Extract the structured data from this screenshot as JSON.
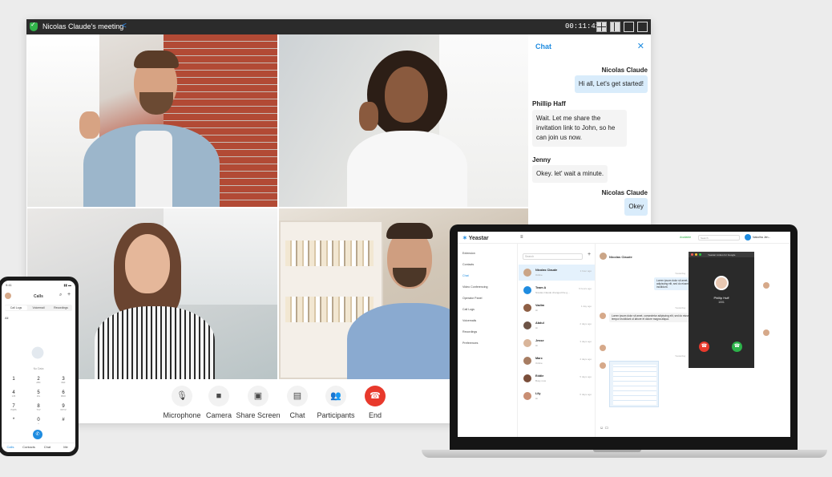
{
  "meeting": {
    "title": "Nicolas Claude's meeting",
    "timer": "00:11:41",
    "controls": [
      {
        "label": "Microphone",
        "icon": "microphone-icon"
      },
      {
        "label": "Camera",
        "icon": "camera-icon"
      },
      {
        "label": "Share Screen",
        "icon": "share-screen-icon"
      },
      {
        "label": "Chat",
        "icon": "chat-icon"
      },
      {
        "label": "Participants",
        "icon": "participants-icon"
      },
      {
        "label": "End",
        "icon": "end-call-icon"
      }
    ],
    "colors": {
      "end": "#e8392c",
      "accent": "#1f8ce0",
      "secure": "#32b34a"
    }
  },
  "chat": {
    "title": "Chat",
    "messages": [
      {
        "sender": "Nicolas Claude",
        "text": "Hi all, Let's get started!",
        "mine": true
      },
      {
        "sender": "Phillip Haff",
        "text": "Wait. Let me share the invitation link to John, so he can join us now.",
        "mine": false
      },
      {
        "sender": "Jenny",
        "text": "Okey. let' wait a minute.",
        "mine": false
      },
      {
        "sender": "Nicolas Claude",
        "text": "Okey",
        "mine": true
      }
    ]
  },
  "phone": {
    "status_time": "9:41",
    "title": "Calls",
    "tabs": [
      "Call Logs",
      "Voicemail",
      "Recordings"
    ],
    "filter": "All",
    "empty_label": "No Data",
    "keypad": [
      {
        "d": "1",
        "l": ""
      },
      {
        "d": "2",
        "l": "ABC"
      },
      {
        "d": "3",
        "l": "DEF"
      },
      {
        "d": "4",
        "l": "GHI"
      },
      {
        "d": "5",
        "l": "JKL"
      },
      {
        "d": "6",
        "l": "MNO"
      },
      {
        "d": "7",
        "l": "PQRS"
      },
      {
        "d": "8",
        "l": "TUV"
      },
      {
        "d": "9",
        "l": "WXYZ"
      },
      {
        "d": "*",
        "l": ""
      },
      {
        "d": "0",
        "l": "+"
      },
      {
        "d": "#",
        "l": ""
      }
    ],
    "nav": [
      "Calls",
      "Contacts",
      "Chat",
      "Me"
    ]
  },
  "laptop": {
    "brand": "Yeastar",
    "availability": "Available",
    "user": "Nakolha Jen...",
    "search_placeholder": "Search",
    "sidebar": [
      "Extension",
      "Contacts",
      "Chat",
      "Video Conferencing",
      "Operator Panel",
      "Call Logs",
      "Voicemails",
      "Recordings",
      "Preferences"
    ],
    "active_sidebar": "Chat",
    "conversations": [
      {
        "name": "Nicolas Claude",
        "sub": "Online",
        "time": "1 hour ago",
        "active": true
      },
      {
        "name": "Team A",
        "sub": "Nicolas Claude changed the g...",
        "time": "6 hours ago",
        "active": false
      },
      {
        "name": "Vadim",
        "sub": "Hi",
        "time": "1 day ago",
        "active": false
      },
      {
        "name": "Abdul",
        "sub": "Hi",
        "time": "2 days ago",
        "active": false
      },
      {
        "name": "Jesse",
        "sub": "Hi",
        "time": "3 days ago",
        "active": false
      },
      {
        "name": "Marc",
        "sub": "Online",
        "time": "4 days ago",
        "active": false
      },
      {
        "name": "Eddie",
        "sub": "Busy now",
        "time": "5 days ago",
        "active": false
      },
      {
        "name": "Lily",
        "sub": "Hi",
        "time": "6 days ago",
        "active": false
      }
    ],
    "conversation": {
      "name": "Nicolas Claude",
      "stamps": [
        "Yesterday",
        "Yesterday",
        "Yesterday"
      ],
      "messages": [
        "Lorem ipsum dolor sit amet, consectetur adipiscing elit, sed do eiusmod tempor incididunt.",
        "Lorem ipsum dolor sit amet, consectetur adipiscing elit, sed do eiusmod tempor incididunt ut labore et dolore magna aliqua."
      ]
    },
    "call_popup": {
      "title": "Yeastar Linkus for Google",
      "caller": "Phillip Huff",
      "number": "1001"
    }
  }
}
